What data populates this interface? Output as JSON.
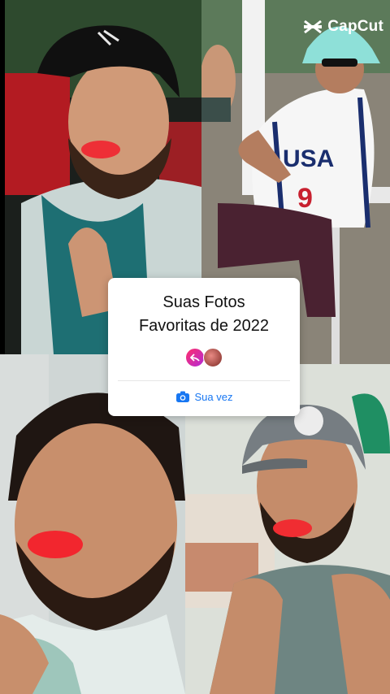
{
  "watermark": {
    "brand": "CapCut",
    "icon": "capcut-logo-icon"
  },
  "prompt_card": {
    "title_line1": "Suas Fotos",
    "title_line2": "Favoritas de 2022",
    "avatars": [
      "reply-arrow-avatar-icon",
      "profile-avatar"
    ],
    "cta_label": "Sua vez",
    "cta_icon": "camera-icon",
    "colors": {
      "card_bg": "#ffffff",
      "cta": "#1877f2",
      "avatar_gradient_start": "#ff2e6a",
      "avatar_gradient_end": "#b22ad8"
    }
  },
  "photos": [
    {
      "name": "photo-top-left"
    },
    {
      "name": "photo-top-right"
    },
    {
      "name": "photo-bottom-left"
    },
    {
      "name": "photo-bottom-right"
    }
  ]
}
